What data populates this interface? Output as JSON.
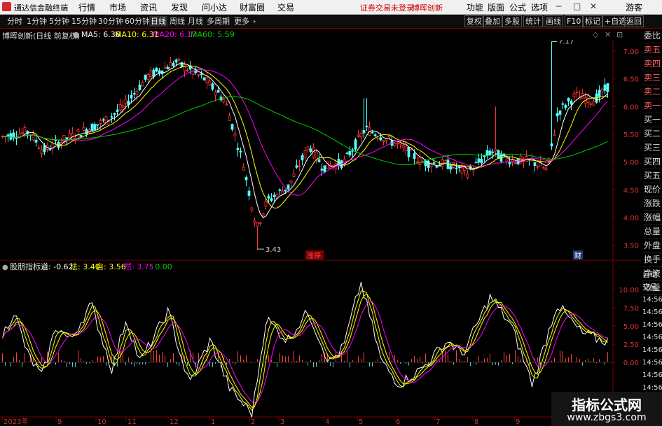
{
  "titlebar": {
    "app_title": "通达信金融终端",
    "menu": [
      "行情",
      "市场",
      "资讯",
      "发现",
      "问小达",
      "财富圈",
      "交易"
    ],
    "notice": "证券交易未登录",
    "stock_name": "博晖创新",
    "right_menu": [
      "功能",
      "版面",
      "公式",
      "选项"
    ],
    "guest": "游客"
  },
  "toolbar": {
    "periods": [
      "分时",
      "1分钟",
      "5分钟",
      "15分钟",
      "30分钟",
      "60分钟",
      "日线",
      "周线",
      "月线",
      "多周期",
      "更多"
    ],
    "active_period": "日线",
    "right_buttons": [
      "复权",
      "叠加",
      "多股",
      "统计",
      "画线",
      "F10",
      "标记",
      "+自选",
      "返回"
    ]
  },
  "infobar": {
    "title": "博晖创新(日线 前复权)",
    "ma5": "MA5: 6.36",
    "ma10": "MA10: 6.31",
    "ma20": "MA20: 6.17",
    "ma60": "MA60: 5.59"
  },
  "colors": {
    "ma5": "#ffffff",
    "ma10": "#ffff00",
    "ma20": "#ff00ff",
    "ma60": "#00cc00",
    "up": "#ff3232",
    "down": "#54ffff",
    "grid": "#7a0000"
  },
  "price_axis": [
    "7.00",
    "6.50",
    "6.00",
    "5.50",
    "5.00",
    "4.50",
    "4.00",
    "3.50"
  ],
  "annotations": {
    "high_label": "7.17",
    "low_label": "3.43",
    "tag_zhangting": "涨停",
    "tag_cai": "财"
  },
  "indicator": {
    "name": "股朋指标",
    "dao": "道: -0.62",
    "fa": "法: 3.40",
    "zi": "自: 3.56",
    "ran": "然: 3.75",
    "zero": ": 0.00",
    "axis": [
      "10.00",
      "7.50",
      "5.00",
      "2.50",
      "0.00"
    ]
  },
  "side_panel": [
    "委比",
    "卖五",
    "卖四",
    "卖三",
    "卖二",
    "卖一",
    "买一",
    "买二",
    "买三",
    "买四",
    "买五",
    "现价",
    "涨跌",
    "涨幅",
    "总量",
    "外盘",
    "换手",
    "净资",
    "收益"
  ],
  "side_panel2": [
    "自动",
    "交易",
    "14:56",
    "14:56",
    "14:56",
    "14:56",
    "14:56",
    "14:56",
    "14:56",
    "14:56",
    "14:56",
    "14:56"
  ],
  "time_axis": [
    "2023年",
    "9",
    "10",
    "11",
    "12",
    "1",
    "2",
    "3",
    "4",
    "5",
    "6",
    "7",
    "8",
    "9"
  ],
  "watermark": {
    "line1": "指标公式网",
    "line2": "www.zbgs3.com"
  }
}
